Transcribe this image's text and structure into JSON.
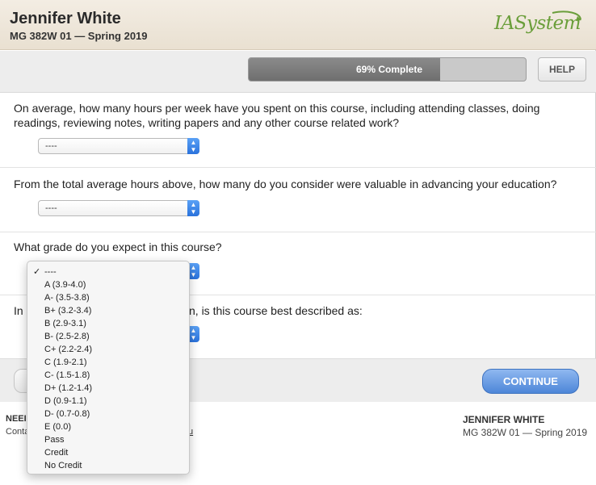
{
  "header": {
    "name": "Jennifer White",
    "course": "MG 382W 01 — Spring 2019",
    "logo_text": "IASystem"
  },
  "toolbar": {
    "progress_fraction": 0.69,
    "progress_label": "69% Complete",
    "help_label": "HELP"
  },
  "questions": [
    {
      "text": "On average, how many hours per week have you spent on this course, including attending classes, doing readings, reviewing notes, writing papers and any other course related work?",
      "selected": "----"
    },
    {
      "text": "From the total average hours above, how many do you consider were valuable in advancing your education?",
      "selected": "----"
    },
    {
      "text": "What grade do you expect in this course?",
      "selected": "----"
    },
    {
      "text_left": "In",
      "text_right": "n, is this course best described as:",
      "selected": "----"
    }
  ],
  "dropdown": {
    "options": [
      "----",
      "A (3.9-4.0)",
      "A- (3.5-3.8)",
      "B+ (3.2-3.4)",
      "B (2.9-3.1)",
      "B- (2.5-2.8)",
      "C+ (2.2-2.4)",
      "C (1.9-2.1)",
      "C- (1.5-1.8)",
      "D+ (1.2-1.4)",
      "D (0.9-1.1)",
      "D- (0.7-0.8)",
      "E (0.0)",
      "Pass",
      "Credit",
      "No Credit"
    ],
    "checked_index": 0,
    "check_glyph": "✓"
  },
  "footer": {
    "continue_label": "CONTINUE",
    "left_title": "NEEI",
    "left_sub": "Conta",
    "link_fragment": "u",
    "right_name": "JENNIFER WHITE",
    "right_course": "MG 382W 01 — Spring 2019"
  },
  "colors": {
    "accent_blue": "#4d86d8",
    "logo_green": "#6a9e3a",
    "progress_fill": "#7a7a7a"
  }
}
